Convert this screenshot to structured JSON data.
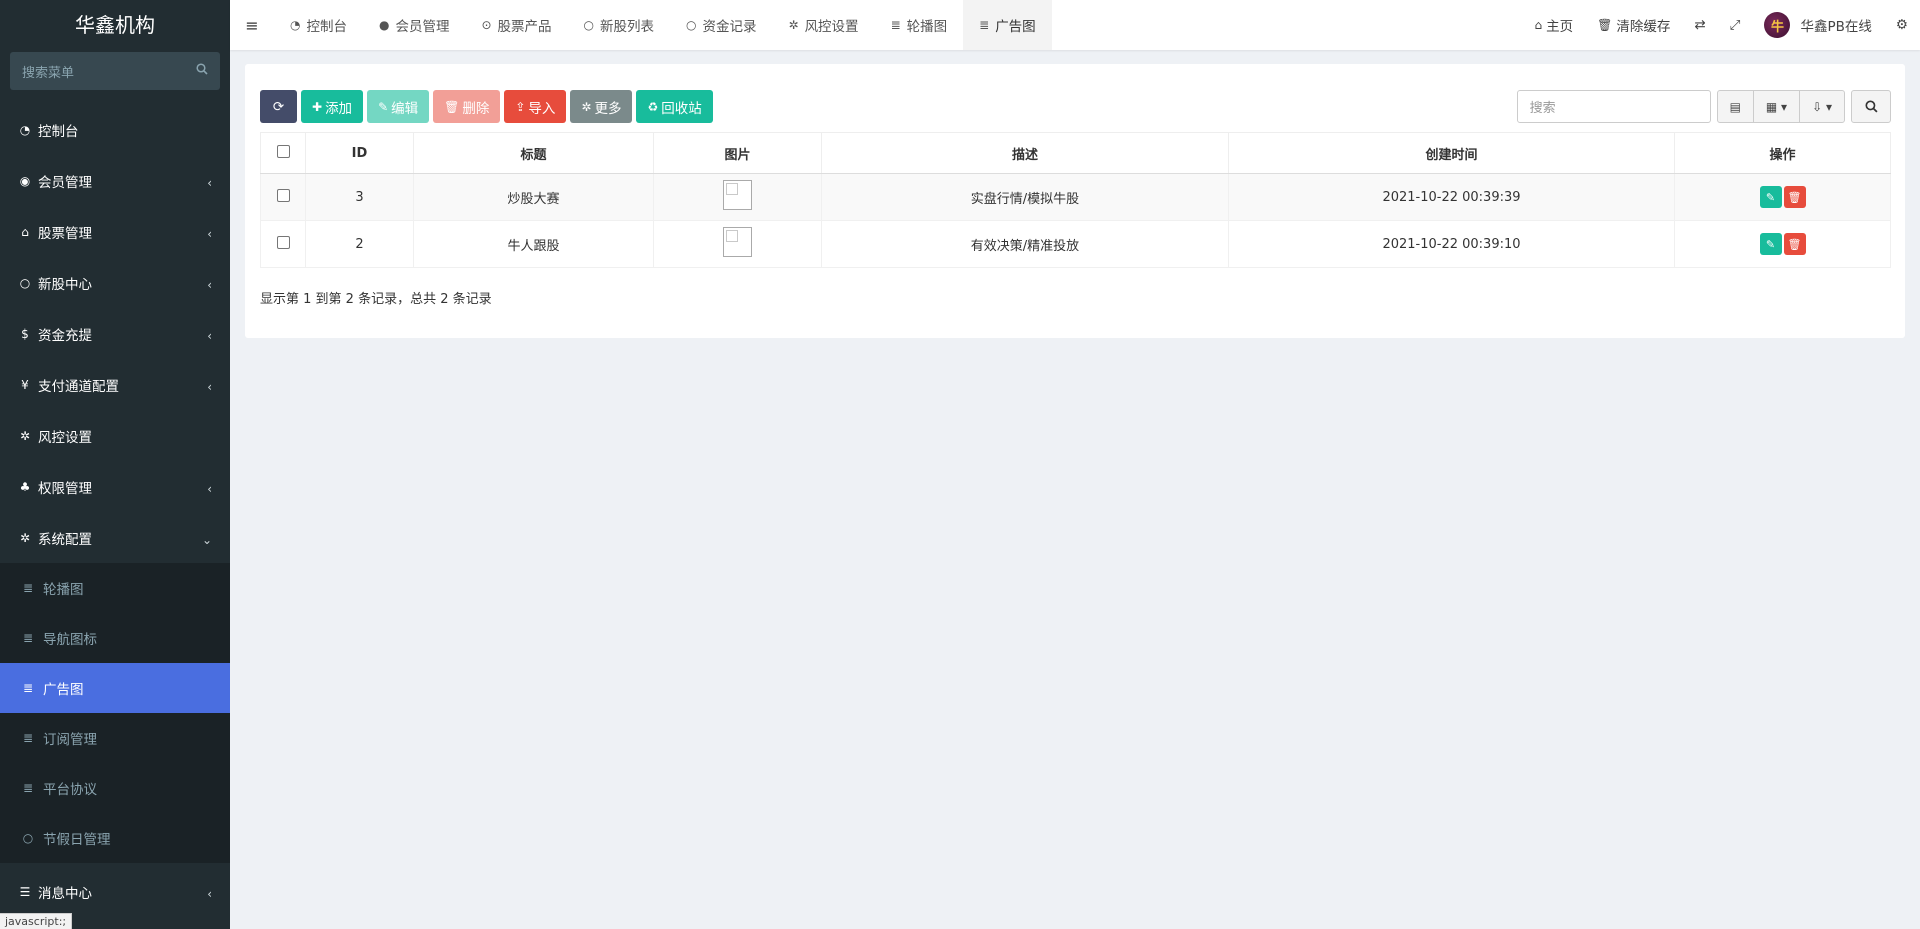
{
  "sidebar": {
    "brand": "华鑫机构",
    "search_placeholder": "搜索菜单",
    "items": [
      {
        "label": "控制台",
        "icon": "dashboard-icon"
      },
      {
        "label": "会员管理",
        "icon": "user-circle-icon"
      },
      {
        "label": "股票管理",
        "icon": "bank-icon"
      },
      {
        "label": "新股中心",
        "icon": "circle-icon"
      },
      {
        "label": "资金充提",
        "icon": "dollar-icon"
      },
      {
        "label": "支付通道配置",
        "icon": "yen-icon"
      },
      {
        "label": "风控设置",
        "icon": "gear-icon"
      },
      {
        "label": "权限管理",
        "icon": "users-icon"
      },
      {
        "label": "系统配置",
        "icon": "gear-icon"
      }
    ],
    "subitems": [
      {
        "label": "轮播图",
        "icon": "list-icon"
      },
      {
        "label": "导航图标",
        "icon": "list-icon"
      },
      {
        "label": "广告图",
        "icon": "list-icon"
      },
      {
        "label": "订阅管理",
        "icon": "list-icon"
      },
      {
        "label": "平台协议",
        "icon": "list-icon"
      },
      {
        "label": "节假日管理",
        "icon": "circle-icon"
      }
    ],
    "last_item": {
      "label": "消息中心",
      "icon": "list-icon"
    },
    "status_text": "javascript:;"
  },
  "header": {
    "tabs": [
      {
        "label": "控制台",
        "icon": "dashboard-icon"
      },
      {
        "label": "会员管理",
        "icon": "user-icon"
      },
      {
        "label": "股票产品",
        "icon": "dot-circle-icon"
      },
      {
        "label": "新股列表",
        "icon": "circle-icon"
      },
      {
        "label": "资金记录",
        "icon": "circle-icon"
      },
      {
        "label": "风控设置",
        "icon": "gear-icon"
      },
      {
        "label": "轮播图",
        "icon": "list-icon"
      },
      {
        "label": "广告图",
        "icon": "list-icon"
      }
    ],
    "right": {
      "home": "主页",
      "clear_cache": "清除缓存",
      "username": "华鑫PB在线",
      "avatar_text": "牛"
    }
  },
  "toolbar": {
    "add": "添加",
    "edit": "编辑",
    "delete": "删除",
    "import": "导入",
    "more": "更多",
    "recycle": "回收站",
    "search_placeholder": "搜索"
  },
  "table": {
    "columns": [
      "ID",
      "标题",
      "图片",
      "描述",
      "创建时间",
      "操作"
    ],
    "rows": [
      {
        "id": "3",
        "title": "炒股大赛",
        "desc": "实盘行情/模拟牛股",
        "created": "2021-10-22 00:39:39"
      },
      {
        "id": "2",
        "title": "牛人跟股",
        "desc": "有效决策/精准投放",
        "created": "2021-10-22 00:39:10"
      }
    ]
  },
  "pagination": {
    "info": "显示第 1 到第 2 条记录，总共 2 条记录"
  },
  "colors": {
    "sidebar_bg": "#222d32",
    "active_blue": "#4a6ee0",
    "green": "#18bc9c",
    "red": "#e74c3c",
    "dark_btn": "#444c69"
  }
}
